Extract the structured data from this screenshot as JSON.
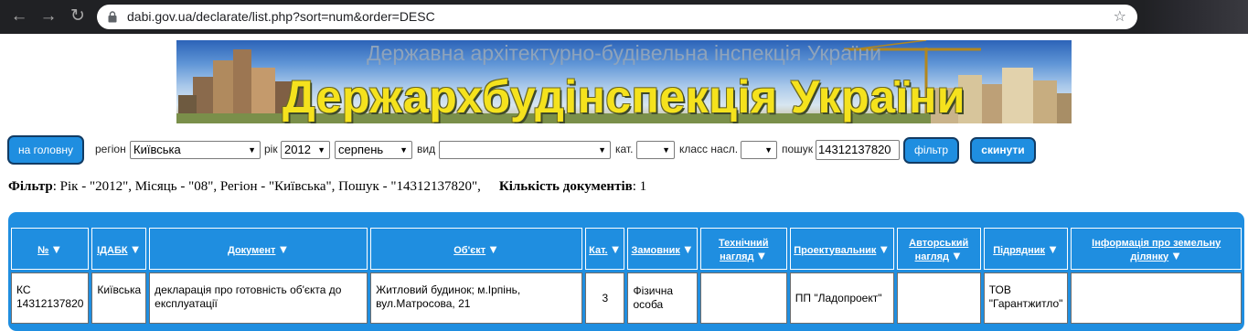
{
  "browser": {
    "url": "dabi.gov.ua/declarate/list.php?sort=num&order=DESC",
    "icons": [
      "back-arrow-icon",
      "forward-arrow-icon",
      "reload-icon",
      "lock-icon",
      "star-icon"
    ]
  },
  "banner": {
    "subtitle": "Державна архітектурно-будівельна інспекція України",
    "title": "Держархбудінспекція України"
  },
  "filters": {
    "home_label": "на головну",
    "region_label": "регіон",
    "region_value": "Київська",
    "year_label": "рік",
    "year_value": "2012",
    "month_value": "серпень",
    "type_label": "вид",
    "type_value": "",
    "category_label": "кат.",
    "category_value": "",
    "class_label": "класс насл.",
    "class_value": "",
    "search_label": "пошук",
    "search_value": "14312137820",
    "filter_label": "фільтр",
    "reset_label": "скинути"
  },
  "summary": {
    "filter_key": "Фільтр",
    "filter_text": ": Рік - \"2012\", Місяць - \"08\", Регіон - \"Київська\", Пошук - \"14312137820\",",
    "count_key": "Кількість документів",
    "count_text": ": 1"
  },
  "table": {
    "headers": [
      "№",
      "ІДАБК",
      "Документ",
      "Об'єкт",
      "Кат.",
      "Замовник",
      "Технічний нагляд",
      "Проектувальник",
      "Авторський нагляд",
      "Підрядник",
      "Інформація про земельну ділянку"
    ],
    "rows": [
      {
        "num": "КС 14312137820",
        "idabk": "Київська",
        "document": "декларація про готовність об'єкта до експлуатації",
        "object": "Житловий будинок; м.Ірпінь, вул.Матросова, 21",
        "category": "3",
        "customer": "Фізична особа",
        "tech_supervision": "",
        "designer": "ПП \"Ладопроект\"",
        "author_supervision": "",
        "contractor": "ТОВ \"Гарантжитло\"",
        "land_info": ""
      }
    ]
  },
  "colors": {
    "accent_blue": "#1f8ee0",
    "banner_title_yellow": "#f5e21d",
    "browser_dark": "#202124"
  }
}
